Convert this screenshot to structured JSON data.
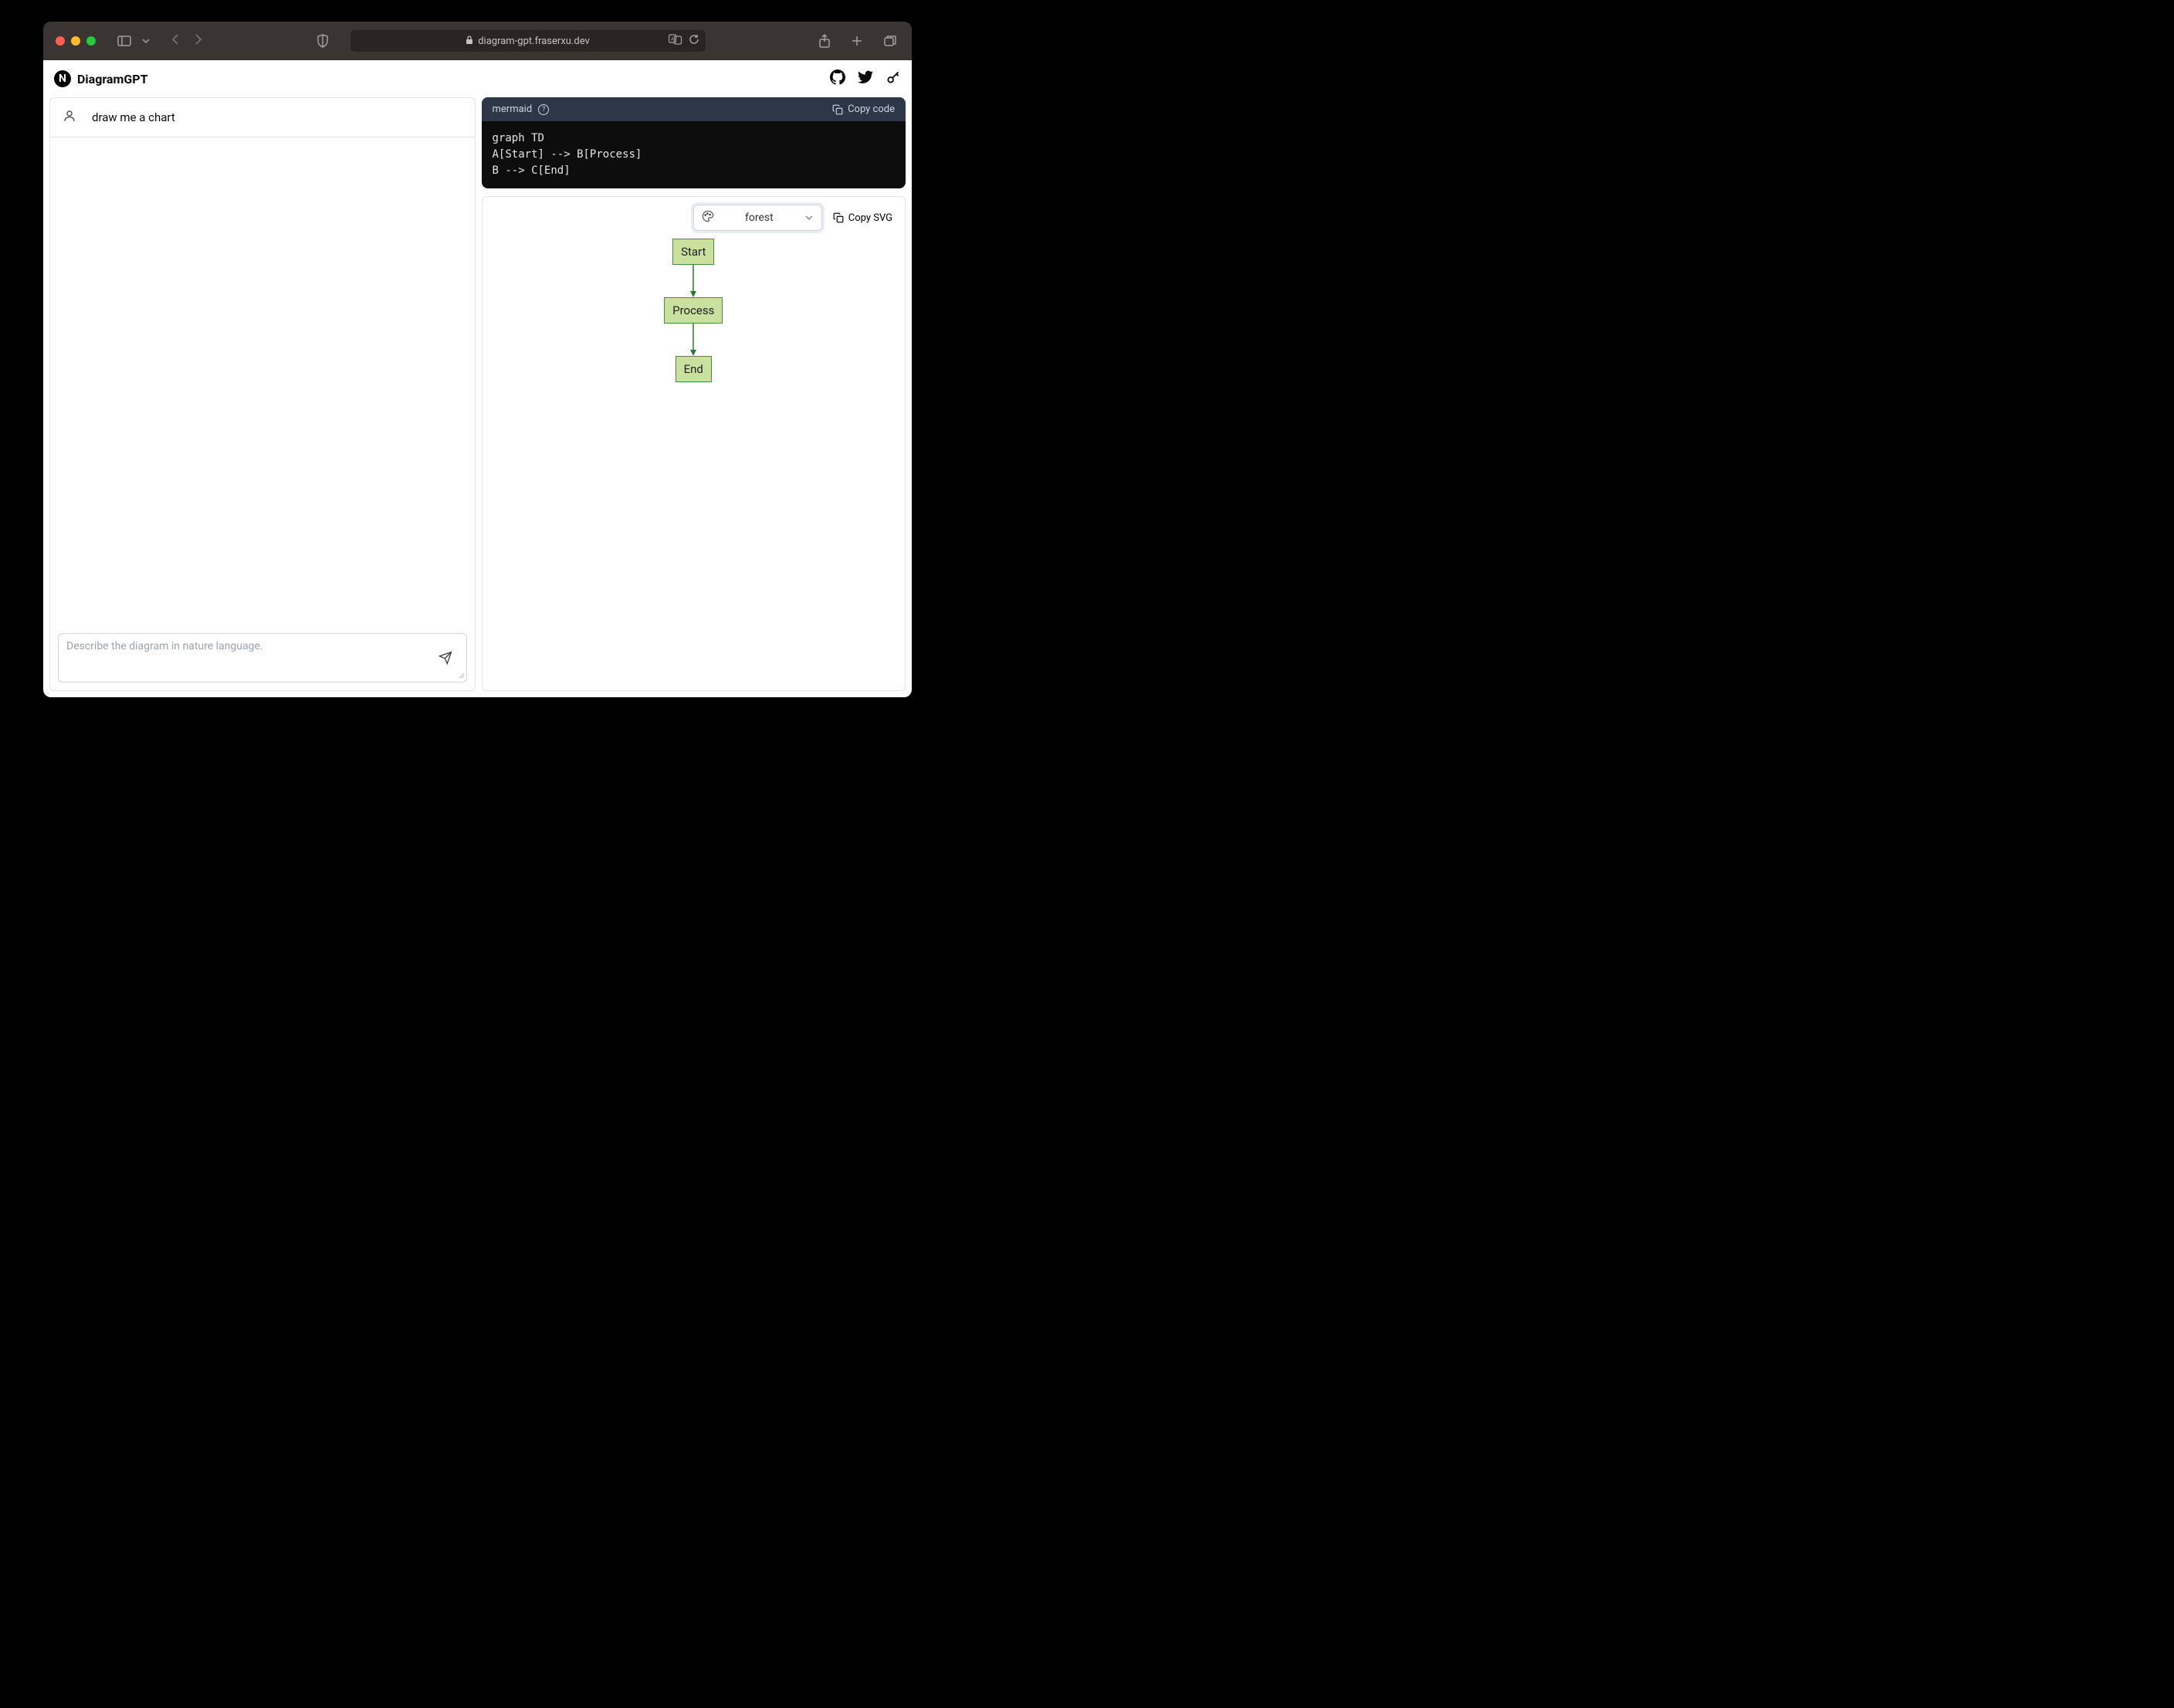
{
  "browser": {
    "url": "diagram-gpt.fraserxu.dev"
  },
  "app": {
    "logo_letter": "N",
    "title": "DiagramGPT"
  },
  "chat": {
    "message": "draw me a chart",
    "input_placeholder": "Describe the diagram in nature language."
  },
  "code": {
    "language": "mermaid",
    "copy_label": "Copy code",
    "content": "graph TD\nA[Start] --> B[Process]\nB --> C[End]"
  },
  "diagram": {
    "theme_label": "forest",
    "copy_svg_label": "Copy SVG",
    "nodes": {
      "a": "Start",
      "b": "Process",
      "c": "End"
    }
  }
}
